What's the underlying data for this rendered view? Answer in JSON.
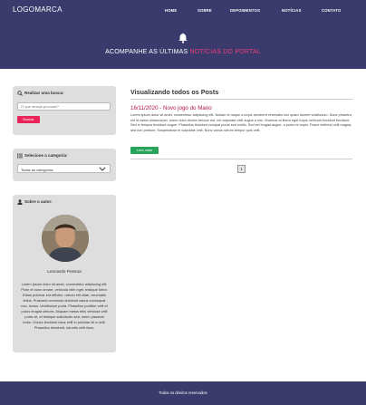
{
  "header": {
    "logo": "LOGOMARCA",
    "nav": [
      "HOME",
      "SOBRE",
      "DEPOIMENTOS",
      "NOTÍCIAS",
      "CONTATO"
    ]
  },
  "hero": {
    "title_prefix": "ACOMPANHE AS ÚLTIMAS",
    "title_accent": "NOTÍCIAS DO PORTAL",
    "icon": "bell-icon"
  },
  "sidebar": {
    "search": {
      "heading": "Realizar uma busca:",
      "placeholder": "O que deseja procurar?",
      "button_label": "Buscar"
    },
    "category": {
      "heading": "Selecione a categoria:",
      "selected": "Todas as categorias"
    },
    "author": {
      "heading": "Sobre o autor:",
      "name": "Leonardo Pessoa",
      "bio": "Lorem ipsum dolor sit amet, consectetur adipiscing elit. Proin et nunc ornare, vehicula nibh eget, tristique tortor. Etiam pulvinar est efficitur, rutrum elit vitae, venenatis tellus. Praesent commodo tincidunt varius consequat non, lectus. Vestibulum porta. Phasellus porttitor velit et purus feugiat ultrices. Aliquam metus felis vehicula velit porta sit, et tristique sollicitudin sed, lorem placerat tortor. Donec tincidunt risus velit in pulvinar sit a velit. Phasellus hendrerit, lobortis velit risus."
    }
  },
  "main": {
    "title": "Visualizando todos os Posts",
    "post": {
      "date_title": "16/11/2020 - Novo jogo do Mario",
      "excerpt": "Lorem ipsum dolor sit amet, consectetur adipiscing elit. Nullam et neque a turpis hendrerit venenatis nec quam laoreet vestibulum. Nunc pharetra, elit id varius ullamcorper, lorem dolor dictum tempor est, vel vulputate velit augue a nisl. Vivamus at libero eget turpis vehicula tincidunt tincidunt. Sed in tempus tincidunt augue. Phasellus tincidunt volutpat purus sed mollis. Sed vel feugiat augue, a porta mi turpis. Fusce eleifend velit magna, sed non pretium. Suspendisse et vulputate velit. Nunc varius rutrum tempor quis velit.",
      "button_label": "Leia mais"
    },
    "pagination": [
      "1"
    ]
  },
  "footer": {
    "text": "Todos os direitos reservados"
  },
  "colors": {
    "brand": "#3b3a6c",
    "accent": "#e8407a",
    "date": "#b0124a",
    "search_button": "#e8245a",
    "read_more_button": "#27a35a"
  }
}
